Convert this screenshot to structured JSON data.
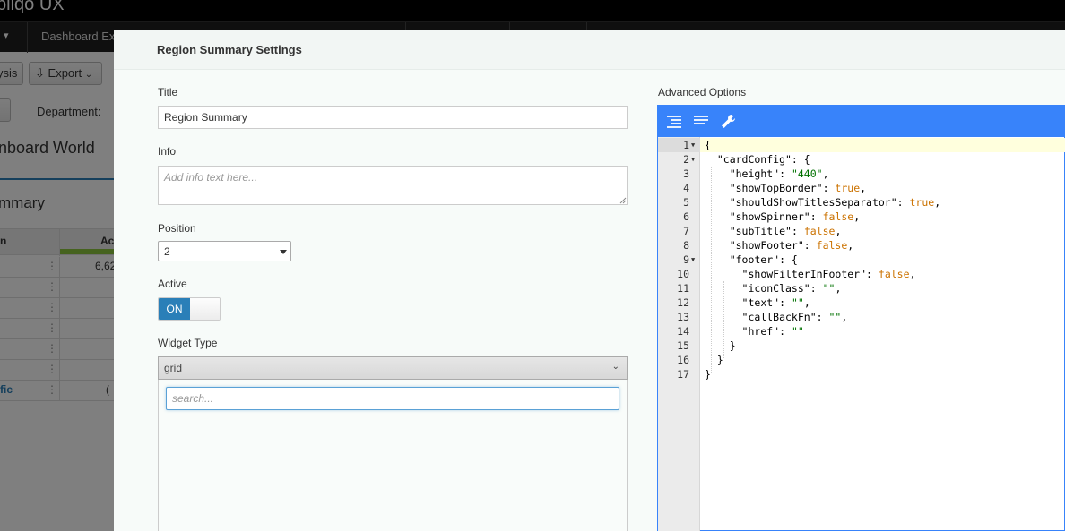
{
  "background": {
    "brand": "bliqo UX",
    "nav_tab": "Dashboard Ex",
    "toolbar": {
      "analysis_label": "ysis",
      "export_label": "Export"
    },
    "filter_label": "Department:",
    "dashboard_title": "nboard World",
    "card_title": "mmary",
    "grid": {
      "headers": [
        "n",
        "Ac"
      ],
      "rows": [
        {
          "name": "",
          "value": "6,62"
        },
        {
          "name": "",
          "value": ""
        },
        {
          "name": "",
          "value": ""
        },
        {
          "name": "",
          "value": ""
        },
        {
          "name": "",
          "value": ""
        },
        {
          "name": "",
          "value": ""
        },
        {
          "name": "fic",
          "value": "("
        }
      ]
    }
  },
  "modal": {
    "title": "Region Summary Settings",
    "fields": {
      "title_label": "Title",
      "title_value": "Region Summary",
      "info_label": "Info",
      "info_placeholder": "Add info text here...",
      "position_label": "Position",
      "position_value": "2",
      "active_label": "Active",
      "active_state": "ON",
      "widget_type_label": "Widget Type",
      "widget_type_value": "grid",
      "widget_search_placeholder": "search..."
    },
    "advanced": {
      "label": "Advanced Options",
      "menu_buttons": [
        "format-icon",
        "compact-icon",
        "repair-icon"
      ],
      "lines": [
        {
          "n": "1",
          "fold": "▼",
          "text": "{"
        },
        {
          "n": "2",
          "fold": "▼",
          "text": "  \"cardConfig\": {"
        },
        {
          "n": "3",
          "fold": "",
          "text": "    \"height\": \"440\","
        },
        {
          "n": "4",
          "fold": "",
          "text": "    \"showTopBorder\": true,"
        },
        {
          "n": "5",
          "fold": "",
          "text": "    \"shouldShowTitlesSeparator\": true,"
        },
        {
          "n": "6",
          "fold": "",
          "text": "    \"showSpinner\": false,"
        },
        {
          "n": "7",
          "fold": "",
          "text": "    \"subTitle\": false,"
        },
        {
          "n": "8",
          "fold": "",
          "text": "    \"showFooter\": false,"
        },
        {
          "n": "9",
          "fold": "▼",
          "text": "    \"footer\": {"
        },
        {
          "n": "10",
          "fold": "",
          "text": "      \"showFilterInFooter\": false,"
        },
        {
          "n": "11",
          "fold": "",
          "text": "      \"iconClass\": \"\","
        },
        {
          "n": "12",
          "fold": "",
          "text": "      \"text\": \"\","
        },
        {
          "n": "13",
          "fold": "",
          "text": "      \"callBackFn\": \"\","
        },
        {
          "n": "14",
          "fold": "",
          "text": "      \"href\": \"\""
        },
        {
          "n": "15",
          "fold": "",
          "text": "    }"
        },
        {
          "n": "16",
          "fold": "",
          "text": "  }"
        },
        {
          "n": "17",
          "fold": "",
          "text": "}"
        }
      ]
    }
  },
  "colors": {
    "editor_accent": "#3883fa",
    "toggle_on": "#2a7fb8",
    "json_string": "#007100",
    "json_boolean": "#cb7200"
  }
}
